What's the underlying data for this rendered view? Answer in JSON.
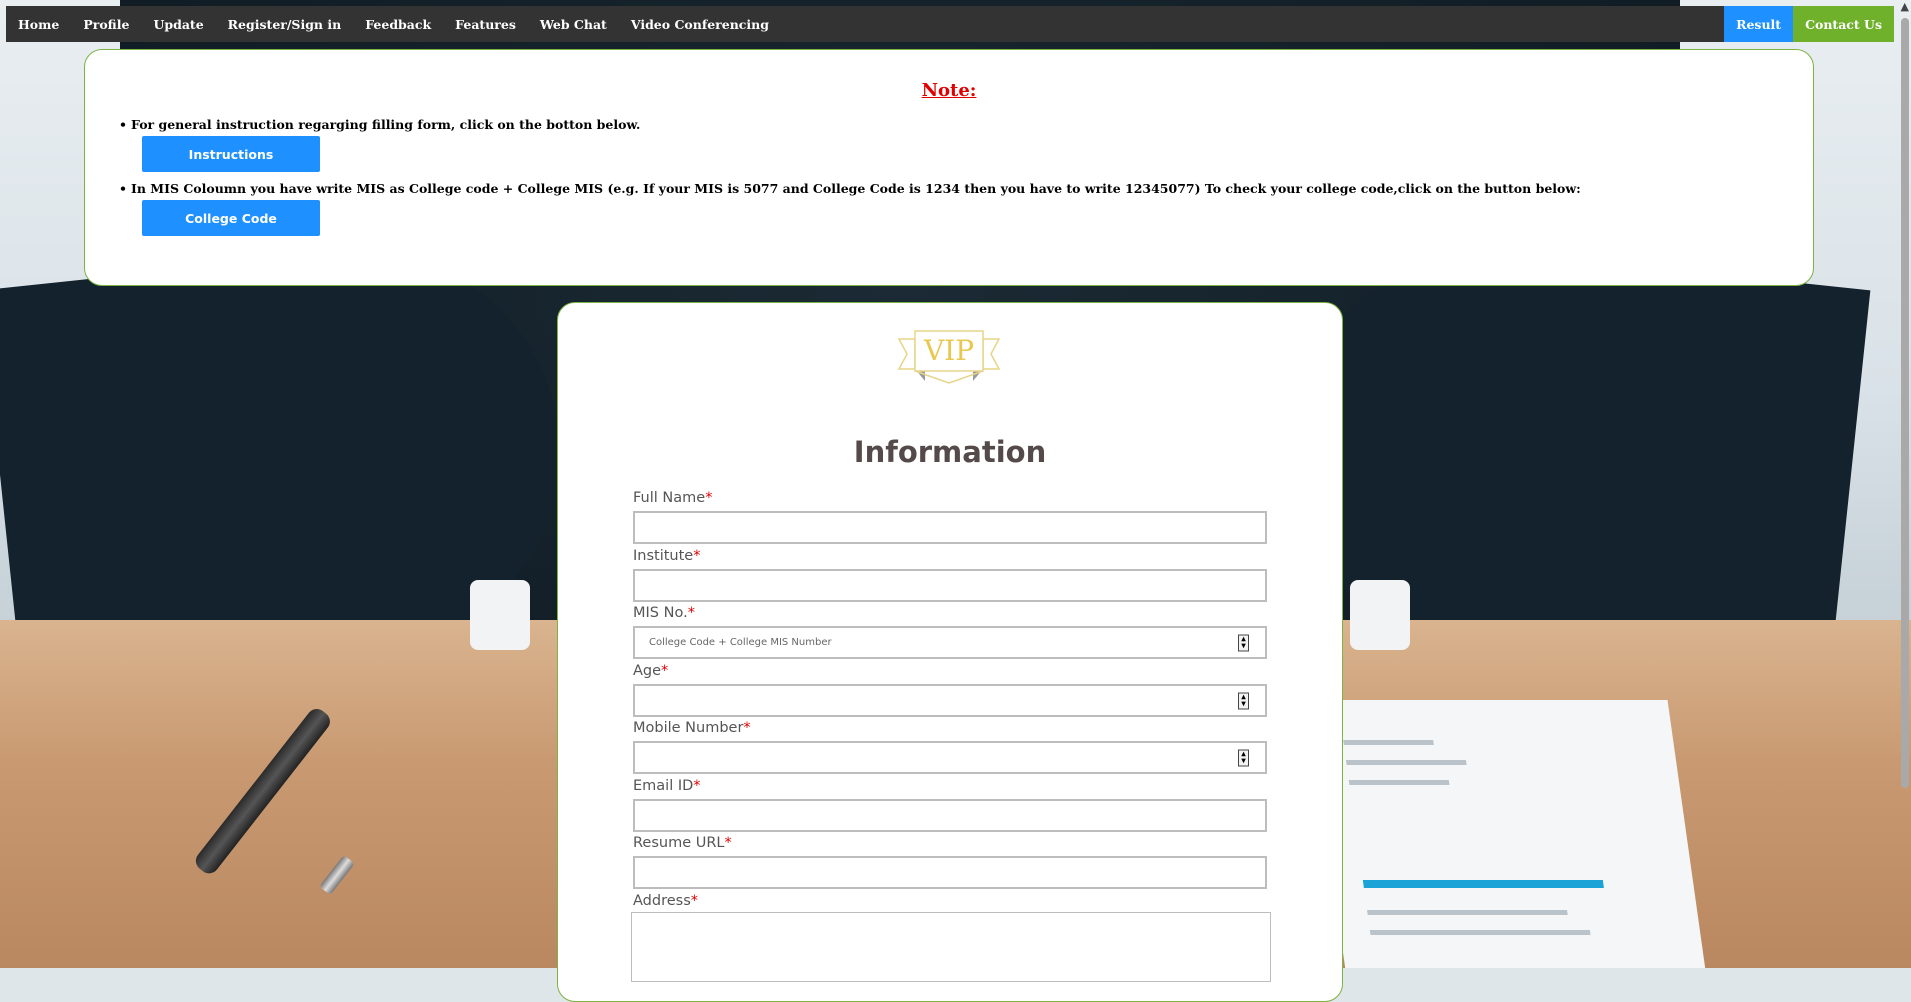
{
  "nav": {
    "items": [
      "Home",
      "Profile",
      "Update",
      "Register/Sign in",
      "Feedback",
      "Features",
      "Web Chat",
      "Video Conferencing"
    ],
    "result": "Result",
    "contact": "Contact Us"
  },
  "note": {
    "title": "Note:",
    "bullet1": "For general instruction regarging filling form, click on the botton below.",
    "instructions_button": "Instructions",
    "bullet2": "In MIS Coloumn you have write MIS as College code + College MIS (e.g. If your MIS is 5077 and College Code is 1234 then you have to write 12345077) To check your college code,click on the button below:",
    "college_code_button": "College Code"
  },
  "form": {
    "logo_text": "VIP",
    "title": "Information",
    "fields": {
      "full_name": "Full Name",
      "institute": "Institute",
      "mis_no": "MIS No.",
      "mis_placeholder": "College Code + College MIS Number",
      "age": "Age",
      "mobile": "Mobile Number",
      "email": "Email ID",
      "resume": "Resume URL",
      "address": "Address"
    },
    "required_mark": "*"
  },
  "colors": {
    "nav_bg": "#333333",
    "result_bg": "#1e90ff",
    "contact_bg": "#6fb12b",
    "panel_border": "#7cb342",
    "note_title": "#e00000",
    "button": "#1e90ff"
  }
}
